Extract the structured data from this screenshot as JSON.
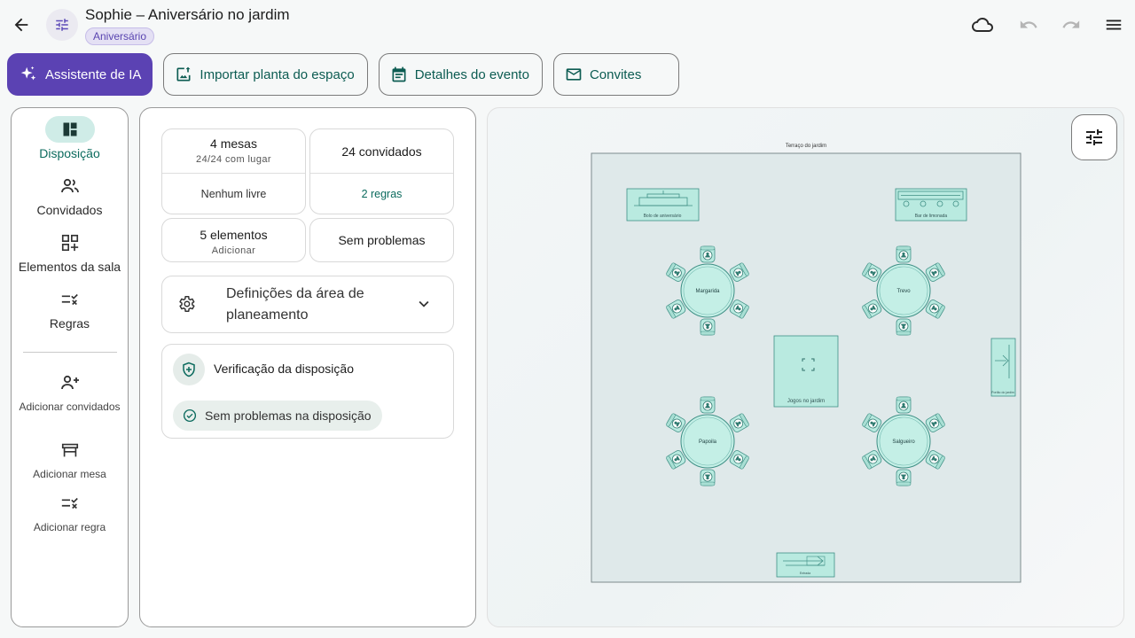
{
  "header": {
    "title": "Sophie – Aniversário no jardim",
    "tag": "Aniversário"
  },
  "actions": {
    "ai": "Assistente de IA",
    "import": "Importar planta do espaço",
    "details": "Detalhes do evento",
    "invites": "Convites"
  },
  "nav": {
    "layout": "Disposição",
    "guests": "Convidados",
    "elements": "Elementos da sala",
    "rules": "Regras",
    "add_guests": "Adicionar convidados",
    "add_table": "Adicionar mesa",
    "add_rule": "Adicionar regra"
  },
  "stats": {
    "tables": "4 mesas",
    "seated": "24/24 com lugar",
    "free": "Nenhum livre",
    "guests": "24 convidados",
    "rules": "2 regras",
    "elements": "5 elementos",
    "add": "Adicionar",
    "problems": "Sem problemas"
  },
  "settings": {
    "label": "Definições da área de planeamento"
  },
  "verification": {
    "title": "Verificação da disposição",
    "status": "Sem problemas na disposição"
  },
  "floorplan": {
    "area_title": "Terraço do jardim",
    "elements": {
      "cake": "Bolo de aniversário",
      "bar": "Bar de limonada",
      "games": "Jogos no jardim",
      "side_door": "Portão do jardim",
      "bottom_door": "Entrada"
    },
    "tables": [
      {
        "name": "Margarida",
        "seats": 6
      },
      {
        "name": "Trevo",
        "seats": 6
      },
      {
        "name": "Papoila",
        "seats": 6
      },
      {
        "name": "Salgueiro",
        "seats": 6
      }
    ]
  },
  "colors": {
    "accent": "#5b42b3",
    "teal": "#0c6b5e",
    "table_fill": "#c4efe6",
    "table_stroke": "#3f8f85"
  }
}
